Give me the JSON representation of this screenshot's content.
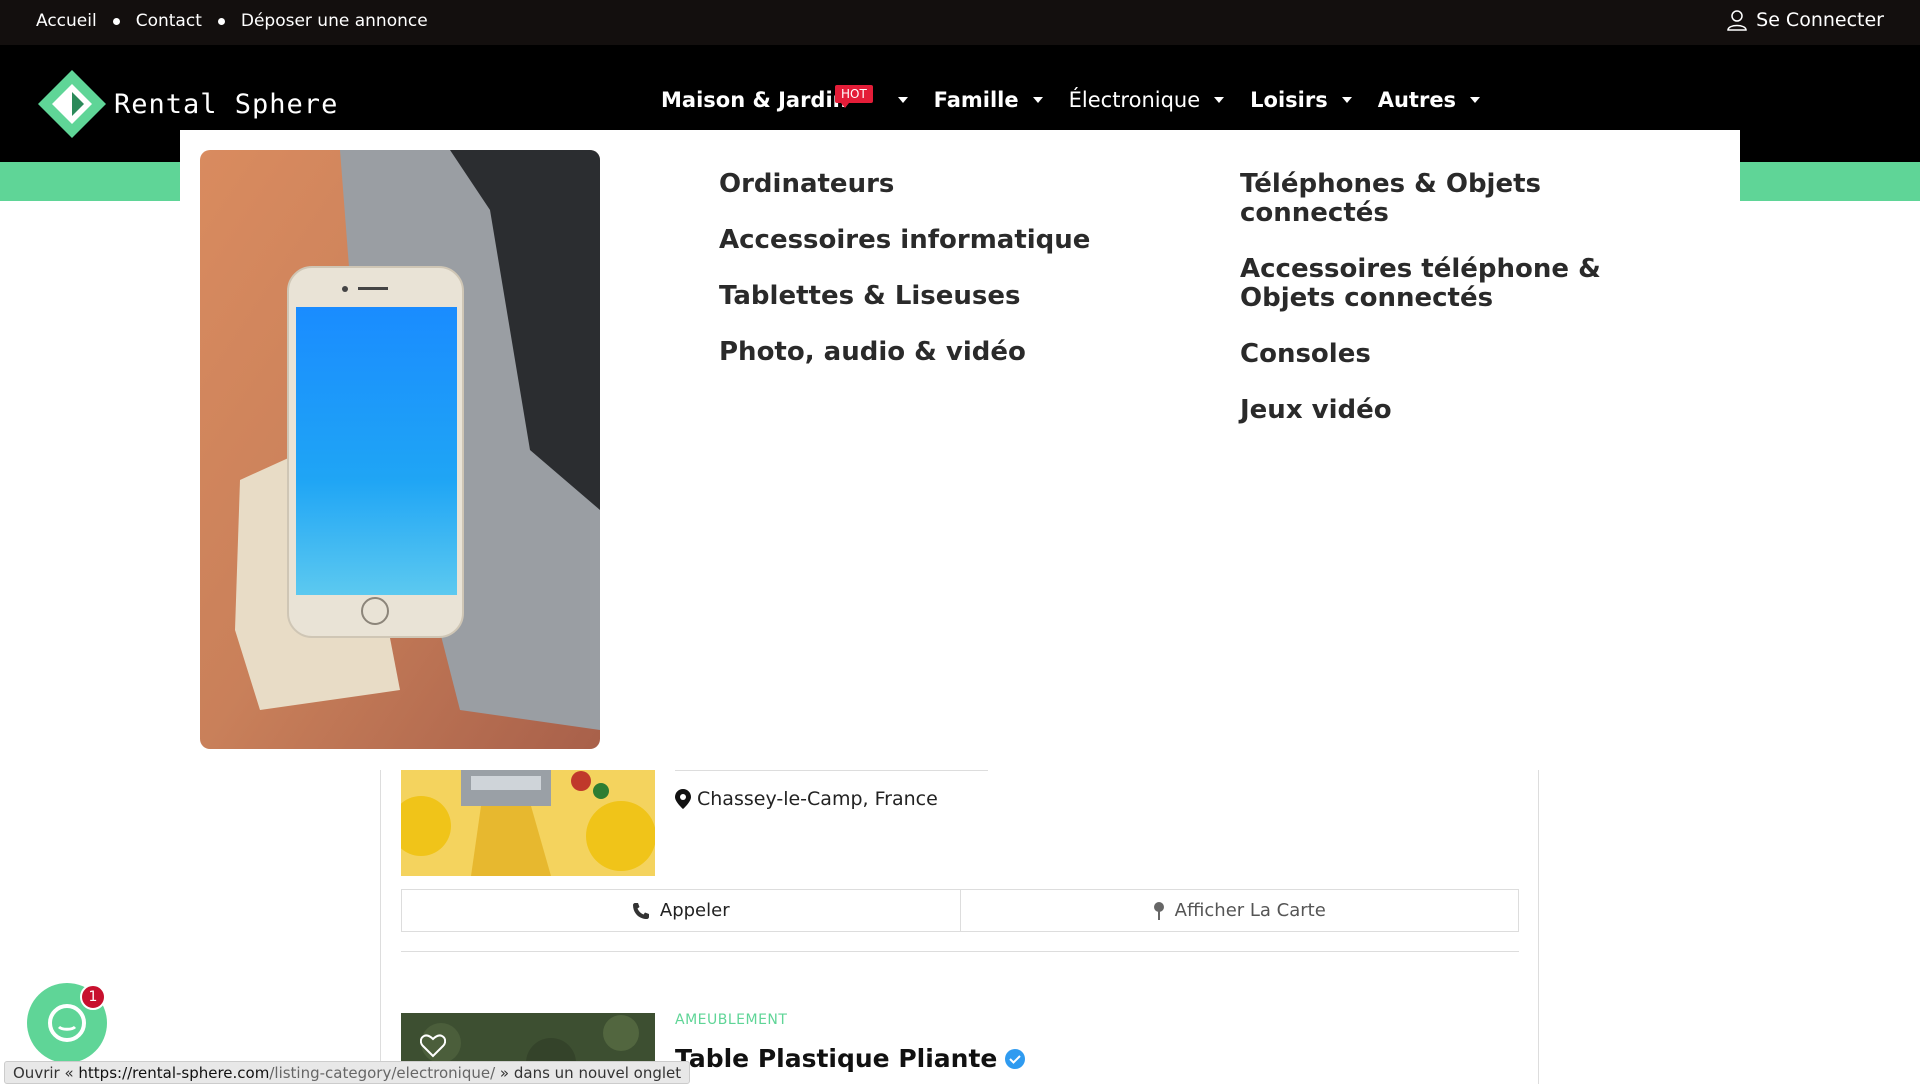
{
  "topbar": {
    "links": [
      "Accueil",
      "Contact",
      "Déposer une annonce"
    ],
    "login_label": "Se Connecter"
  },
  "brand": {
    "name": "Rental Sphere"
  },
  "nav": {
    "items": [
      {
        "label": "Maison & Jardin",
        "badge": "HOT"
      },
      {
        "label": "Famille"
      },
      {
        "label": "Électronique"
      },
      {
        "label": "Loisirs"
      },
      {
        "label": "Autres"
      }
    ]
  },
  "megamenu": {
    "col1": [
      "Ordinateurs",
      "Accessoires informatique",
      "Tablettes & Liseuses",
      "Photo, audio & vidéo"
    ],
    "col2": [
      "Téléphones & Objets connectés",
      "Accessoires téléphone & Objets connectés",
      "Consoles",
      "Jeux vidéo"
    ]
  },
  "listing": {
    "location": "Chassey-le-Camp, France",
    "call_label": "Appeler",
    "map_label": "Afficher La Carte",
    "next_category": "AMEUBLEMENT",
    "next_title": "Table Plastique Pliante"
  },
  "chat": {
    "badge_count": "1"
  },
  "statusbar": {
    "prefix": "Ouvrir « ",
    "host": "https://rental-sphere.com",
    "path": "/listing-category/electronique/",
    "suffix": " » dans un nouvel onglet"
  },
  "colors": {
    "accent": "#5fd597",
    "hot": "#e41d38",
    "topbar": "#130f0e"
  }
}
